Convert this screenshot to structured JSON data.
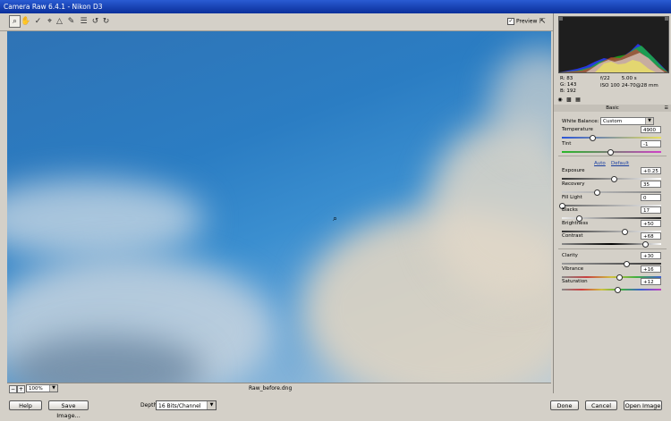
{
  "window": {
    "title": "Camera Raw 6.4.1  -  Nikon D3"
  },
  "toolbar": {
    "tools": [
      "zoom-icon",
      "hand-icon",
      "white-balance-icon",
      "crop-icon",
      "straighten-icon",
      "spot-removal-icon",
      "preferences-icon",
      "rotate-ccw-icon",
      "rotate-cw-icon"
    ],
    "preview_label": "Preview",
    "preview_checked": true
  },
  "status": {
    "zoom": "100%",
    "filename": "Raw_before.dng"
  },
  "bottom": {
    "help_label": "Help",
    "save_label": "Save Image...",
    "depth_label": "Depth:",
    "depth_value": "16 Bits/Channel",
    "done_label": "Done",
    "cancel_label": "Cancel",
    "open_label": "Open Image"
  },
  "info": {
    "r_label": "R:",
    "r_value": "83",
    "g_label": "G:",
    "g_value": "143",
    "b_label": "B:",
    "b_value": "192",
    "aperture": "f/22",
    "shutter": "5.00 s",
    "iso": "ISO 100",
    "lens": "24-70@28 mm"
  },
  "panel": {
    "section_title": "Basic",
    "white_balance_label": "White Balance:",
    "white_balance_value": "Custom",
    "auto_label": "Auto",
    "default_label": "Default",
    "sliders": {
      "temperature": {
        "label": "Temperature",
        "value": "4900",
        "fraction": 0.31
      },
      "tint": {
        "label": "Tint",
        "value": "-1",
        "fraction": 0.49
      },
      "exposure": {
        "label": "Exposure",
        "value": "+0.25",
        "fraction": 0.52
      },
      "recovery": {
        "label": "Recovery",
        "value": "35",
        "fraction": 0.35
      },
      "fill_light": {
        "label": "Fill Light",
        "value": "0",
        "fraction": 0.0
      },
      "blacks": {
        "label": "Blacks",
        "value": "17",
        "fraction": 0.17
      },
      "brightness": {
        "label": "Brightness",
        "value": "+50",
        "fraction": 0.63
      },
      "contrast": {
        "label": "Contrast",
        "value": "+68",
        "fraction": 0.84
      },
      "clarity": {
        "label": "Clarity",
        "value": "+30",
        "fraction": 0.65
      },
      "vibrance": {
        "label": "Vibrance",
        "value": "+16",
        "fraction": 0.58
      },
      "saturation": {
        "label": "Saturation",
        "value": "+12",
        "fraction": 0.56
      }
    }
  }
}
